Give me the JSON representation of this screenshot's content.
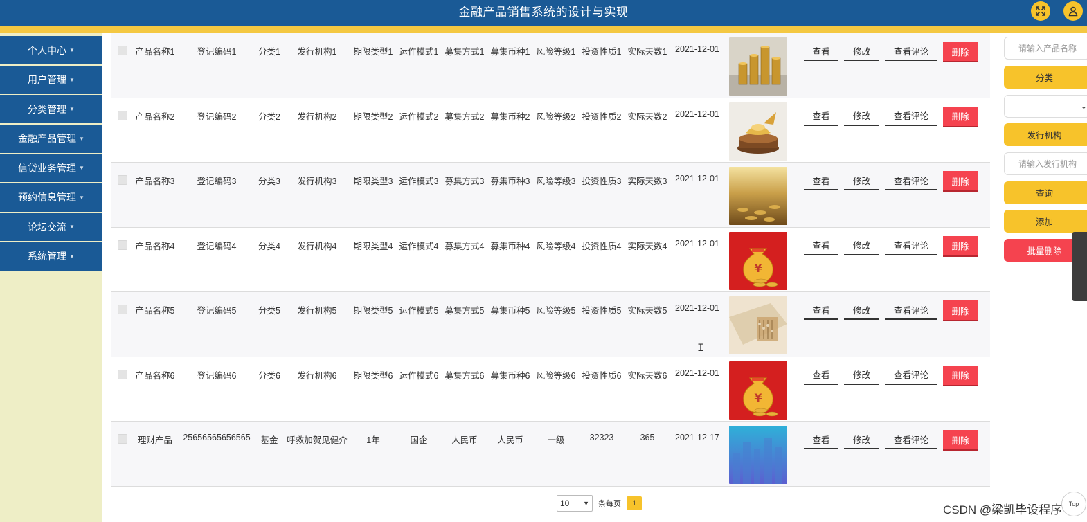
{
  "header": {
    "title": "金融产品销售系统的设计与实现",
    "fullscreen_icon": "expand-icon",
    "user_icon": "user-icon"
  },
  "sidebar": {
    "items": [
      {
        "label": "个人中心"
      },
      {
        "label": "用户管理"
      },
      {
        "label": "分类管理"
      },
      {
        "label": "金融产品管理"
      },
      {
        "label": "信贷业务管理"
      },
      {
        "label": "预约信息管理"
      },
      {
        "label": "论坛交流"
      },
      {
        "label": "系统管理"
      }
    ]
  },
  "actions": {
    "view": "查看",
    "edit": "修改",
    "comments": "查看评论",
    "delete": "删除"
  },
  "rows": [
    {
      "name": "产品名称1",
      "code": "登记编码1",
      "category": "分类1",
      "issuer": "发行机构1",
      "term": "期限类型1",
      "mode": "运作模式1",
      "raise": "募集方式1",
      "currency": "募集币种1",
      "risk": "风险等级1",
      "nature": "投资性质1",
      "days": "实际天数1",
      "date": "2021-12-01",
      "image": "gold-coins"
    },
    {
      "name": "产品名称2",
      "code": "登记编码2",
      "category": "分类2",
      "issuer": "发行机构2",
      "term": "期限类型2",
      "mode": "运作模式2",
      "raise": "募集方式2",
      "currency": "募集币种2",
      "risk": "风险等级2",
      "nature": "投资性质2",
      "days": "实际天数2",
      "date": "2021-12-01",
      "image": "golden-ingot"
    },
    {
      "name": "产品名称3",
      "code": "登记编码3",
      "category": "分类3",
      "issuer": "发行机构3",
      "term": "期限类型3",
      "mode": "运作模式3",
      "raise": "募集方式3",
      "currency": "募集币种3",
      "risk": "风险等级3",
      "nature": "投资性质3",
      "days": "实际天数3",
      "date": "2021-12-01",
      "image": "gold-coin-pile"
    },
    {
      "name": "产品名称4",
      "code": "登记编码4",
      "category": "分类4",
      "issuer": "发行机构4",
      "term": "期限类型4",
      "mode": "运作模式4",
      "raise": "募集方式4",
      "currency": "募集币种4",
      "risk": "风险等级4",
      "nature": "投资性质4",
      "days": "实际天数4",
      "date": "2021-12-01",
      "image": "money-bag-red"
    },
    {
      "name": "产品名称5",
      "code": "登记编码5",
      "category": "分类5",
      "issuer": "发行机构5",
      "term": "期限类型5",
      "mode": "运作模式5",
      "raise": "募集方式5",
      "currency": "募集币种5",
      "risk": "风险等级5",
      "nature": "投资性质5",
      "days": "实际天数5",
      "date": "2021-12-01",
      "image": "banknotes-abacus"
    },
    {
      "name": "产品名称6",
      "code": "登记编码6",
      "category": "分类6",
      "issuer": "发行机构6",
      "term": "期限类型6",
      "mode": "运作模式6",
      "raise": "募集方式6",
      "currency": "募集币种6",
      "risk": "风险等级6",
      "nature": "投资性质6",
      "days": "实际天数6",
      "date": "2021-12-01",
      "image": "money-bag-red"
    },
    {
      "name": "理财产品",
      "code": "25656565656565",
      "category": "基金",
      "issuer": "呼救加贺见健介",
      "term": "1年",
      "mode": "国企",
      "raise": "人民币",
      "currency": "人民币",
      "risk": "一级",
      "nature": "32323",
      "days": "365",
      "date": "2021-12-17",
      "image": "city-skyline"
    }
  ],
  "pagination": {
    "page_size": "10",
    "per_page_label": "条每页",
    "current_page": "1"
  },
  "search_panel": {
    "product_name_placeholder": "请输入产品名称",
    "category_label": "分类",
    "category_select_value": "",
    "issuer_label": "发行机构",
    "issuer_placeholder": "请输入发行机构",
    "query_button": "查询",
    "add_button": "添加",
    "batch_delete_button": "批量删除"
  },
  "back_to_top": "Top",
  "watermark": "CSDN @梁凯毕设程序",
  "colors": {
    "header": "#1a5a96",
    "accent": "#f7c32b",
    "danger": "#f5434f",
    "sidebar_bg": "#eeeec6"
  }
}
